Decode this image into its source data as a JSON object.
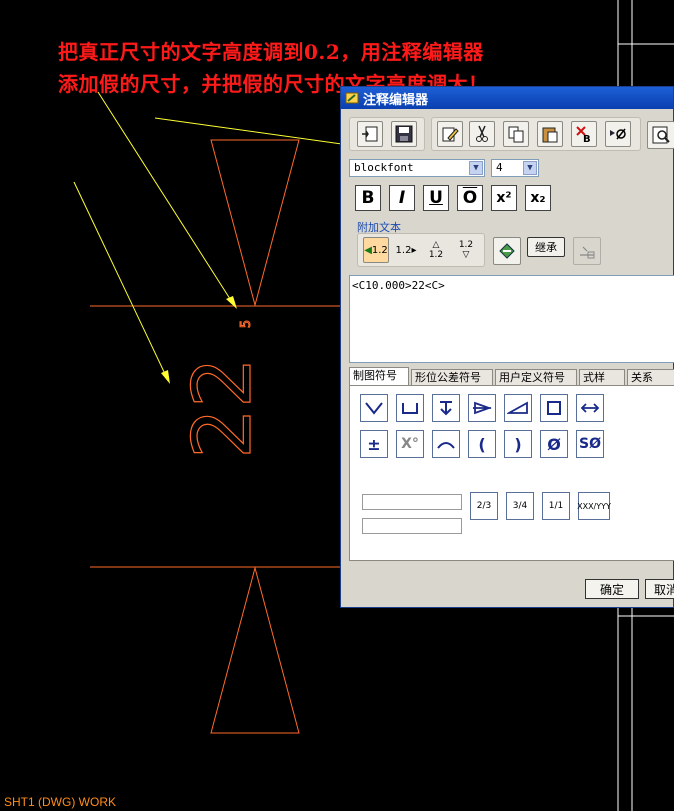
{
  "instructions": {
    "line1": "把真正尺寸的文字高度调到0.2，用注释编辑器",
    "line2": "添加假的尺寸，并把假的尺寸的文字高度调大！"
  },
  "cad": {
    "dimension_text": "22",
    "small_text": "5",
    "status_bar": "SHT1 (DWG) WORK"
  },
  "dialog": {
    "title": "注释编辑器",
    "font_select": "blockfont",
    "size_select": "4",
    "format_buttons": [
      "B",
      "I",
      "U",
      "O",
      "x²",
      "x₂"
    ],
    "append_group_label": "附加文本",
    "append_buttons": [
      "1.2",
      "1.2",
      "1.2",
      "1.2"
    ],
    "inherit_button": "继承",
    "text_content": "<C10.000>22<C>",
    "tabs": [
      "制图符号",
      "形位公差符号",
      "用户定义符号",
      "式样",
      "关系"
    ],
    "fraction_buttons": [
      "2/3",
      "3/4",
      "1/1",
      "XXX/YYY"
    ],
    "ok_button": "确定",
    "cancel_button": "取消"
  },
  "colors": {
    "cad_background": "#000000",
    "geometry": "#ff6a2a",
    "annotation_arrow": "#ffff33",
    "instruction_text": "#ff1a1a",
    "dialog_title": "#0a3fb0"
  }
}
